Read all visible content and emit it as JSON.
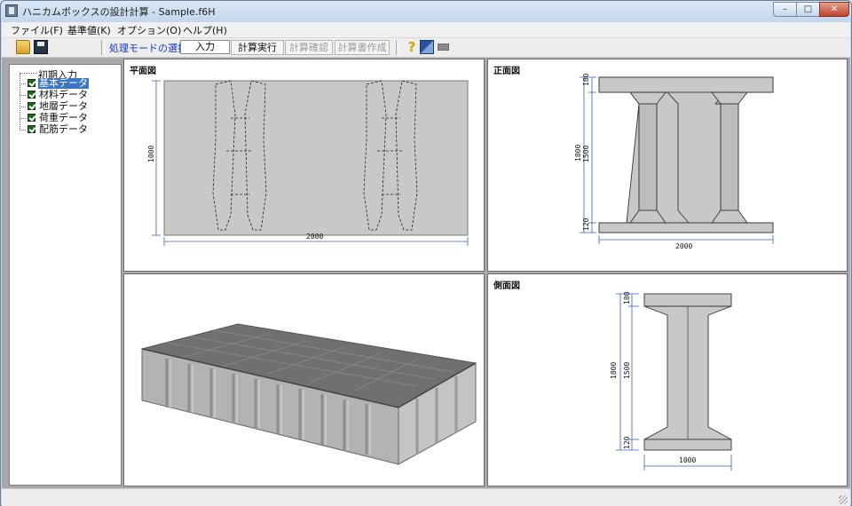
{
  "window": {
    "title": "ハニカムボックスの設計計算 - Sample.f6H"
  },
  "menu": [
    "ファイル(F)",
    "基準値(K)",
    "オプション(O)",
    "ヘルプ(H)"
  ],
  "toolbar": {
    "mode_label": "処理モードの選択",
    "mode_value": "入力",
    "buttons": [
      "計算実行",
      "計算確認",
      "計算書作成"
    ],
    "disabled": [
      false,
      true,
      true
    ]
  },
  "tree": {
    "root": "初期入力",
    "items": [
      "基本データ",
      "材料データ",
      "地層データ",
      "荷重データ",
      "配筋データ"
    ],
    "selected_index": 0
  },
  "panes": {
    "plan": {
      "title": "平面図",
      "width_dim": "2000",
      "height_dim": "1000"
    },
    "front": {
      "title": "正面図",
      "dim_total": "1800",
      "dim_top": "180",
      "dim_mid": "1500",
      "dim_bottom": "120",
      "width_dim": "2000"
    },
    "side": {
      "title": "側面図",
      "dim_total": "1800",
      "dim_top": "180",
      "dim_mid": "1500",
      "dim_bottom": "120",
      "width_dim": "1000"
    }
  },
  "colors": {
    "section_fill": "#c8c8c8",
    "dim_line": "#3a63b8",
    "plan_fill": "#c8c8c8"
  }
}
